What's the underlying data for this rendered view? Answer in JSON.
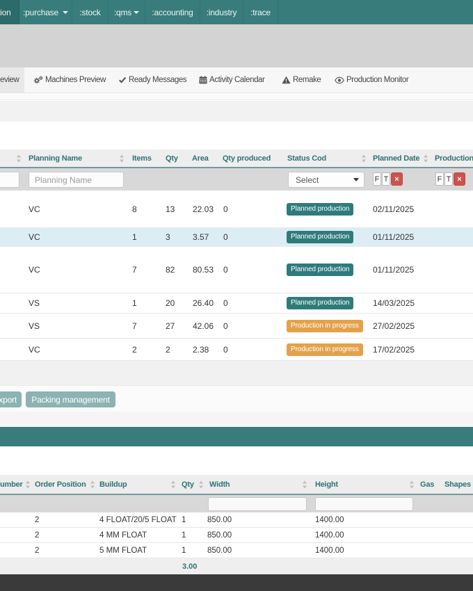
{
  "navbar": {
    "items": [
      {
        "label": "tion",
        "active": true,
        "caret": false
      },
      {
        "label": ":purchase",
        "active": false,
        "caret": true
      },
      {
        "label": ":stock",
        "active": false,
        "caret": false
      },
      {
        "label": ":qms",
        "active": false,
        "caret": true
      },
      {
        "label": ":accounting",
        "active": false,
        "caret": false
      },
      {
        "label": ":industry",
        "active": false,
        "caret": false
      },
      {
        "label": ":trace",
        "active": false,
        "caret": false
      }
    ]
  },
  "tabs": [
    {
      "label": "eview",
      "icon": "none",
      "active": true
    },
    {
      "label": "Machines Preview",
      "icon": "gears",
      "active": false
    },
    {
      "label": "Ready Messages",
      "icon": "check",
      "active": false
    },
    {
      "label": "Activity Calendar",
      "icon": "calendar",
      "active": false
    },
    {
      "label": "Remake",
      "icon": "warning",
      "active": false
    },
    {
      "label": "Production Monitor",
      "icon": "eye",
      "active": false
    }
  ],
  "planning_table": {
    "headers": {
      "planning_name": "Planning Name",
      "items": "Items",
      "qty": "Qty",
      "area": "Area",
      "qty_produced": "Qty produced",
      "status_code": "Status Cod",
      "planned_date": "Planned Date",
      "production": "Production"
    },
    "filter": {
      "planning_name_placeholder": "Planning Name",
      "status_select_value": "Select",
      "from_label": "F",
      "to_label": "T",
      "clear_label": "×"
    },
    "rows": [
      {
        "name": "VC",
        "items": "8",
        "qty": "13",
        "area": "22.03",
        "qty_produced": "0",
        "status": "Planned production",
        "variant": "planned",
        "planned_date": "02/11/2025"
      },
      {
        "name": "VC",
        "items": "1",
        "qty": "3",
        "area": "3.57",
        "qty_produced": "0",
        "status": "Planned production",
        "variant": "planned",
        "planned_date": "01/11/2025"
      },
      {
        "name": "VC",
        "items": "7",
        "qty": "82",
        "area": "80.53",
        "qty_produced": "0",
        "status": "Planned production",
        "variant": "planned",
        "planned_date": "01/11/2025"
      },
      {
        "name": "VS",
        "items": "1",
        "qty": "20",
        "area": "26.40",
        "qty_produced": "0",
        "status": "Planned production",
        "variant": "planned",
        "planned_date": "14/03/2025"
      },
      {
        "name": "VS",
        "items": "7",
        "qty": "27",
        "area": "42.06",
        "qty_produced": "0",
        "status": "Production in progress",
        "variant": "progress",
        "planned_date": "27/02/2025"
      },
      {
        "name": "VC",
        "items": "2",
        "qty": "2",
        "area": "2.38",
        "qty_produced": "0",
        "status": "Production in progress",
        "variant": "progress",
        "planned_date": "17/02/2025"
      }
    ]
  },
  "actions": {
    "export_label": "xport",
    "packing_label": "Packing management"
  },
  "items_table": {
    "headers": {
      "number": "umber",
      "order_position": "Order Position",
      "buildup": "Buildup",
      "qty": "Qty",
      "width": "Width",
      "height": "Height",
      "gas": "Gas",
      "shapes": "Shapes"
    },
    "rows": [
      {
        "order_position": "2",
        "buildup": "4 FLOAT/20/5 FLOAT",
        "qty": "1",
        "width": "850.00",
        "height": "1400.00"
      },
      {
        "order_position": "2",
        "buildup": "4 MM FLOAT",
        "qty": "1",
        "width": "850.00",
        "height": "1400.00"
      },
      {
        "order_position": "2",
        "buildup": "5 MM FLOAT",
        "qty": "1",
        "width": "850.00",
        "height": "1400.00"
      }
    ],
    "qty_total": "3.00"
  },
  "colors": {
    "accent_teal": "#387c7c",
    "active_teal": "#2d6a6a",
    "header_text_teal": "#2e7373",
    "badge_planned": "#2f7b7b",
    "badge_progress": "#e3a14b",
    "danger_red": "#cb544e",
    "row_highlight": "#ddedf4",
    "footer_dark": "#3a3a3a",
    "button_teal": "#8cb2b2"
  }
}
